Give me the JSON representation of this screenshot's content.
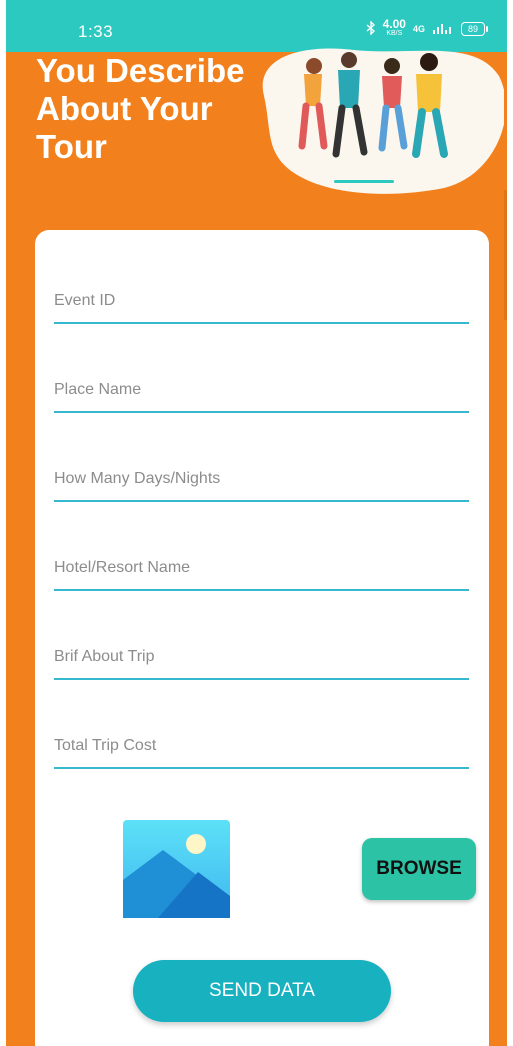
{
  "status_bar": {
    "time": "1:33",
    "speed_value": "4.00",
    "speed_unit": "KB/S",
    "network": "4G",
    "battery": "89"
  },
  "header": {
    "title": "You Describe\nAbout Your\nTour",
    "illustration": "group-of-friends-illustration"
  },
  "form": {
    "fields": [
      {
        "placeholder": "Event ID",
        "value": ""
      },
      {
        "placeholder": "Place Name",
        "value": ""
      },
      {
        "placeholder": "How Many Days/Nights",
        "value": ""
      },
      {
        "placeholder": "Hotel/Resort Name",
        "value": ""
      },
      {
        "placeholder": "Brif About Trip",
        "value": ""
      },
      {
        "placeholder": "Total Trip Cost",
        "value": ""
      }
    ],
    "image_icon": "image-placeholder-icon",
    "browse_label": "BROWSE",
    "send_label": "SEND DATA"
  },
  "colors": {
    "status_bar": "#2CC9C0",
    "background": "#F2811D",
    "card": "#FFFFFF",
    "underline": "#36B9CF",
    "browse_button": "#2CC2A5",
    "send_button": "#17B1C0"
  }
}
